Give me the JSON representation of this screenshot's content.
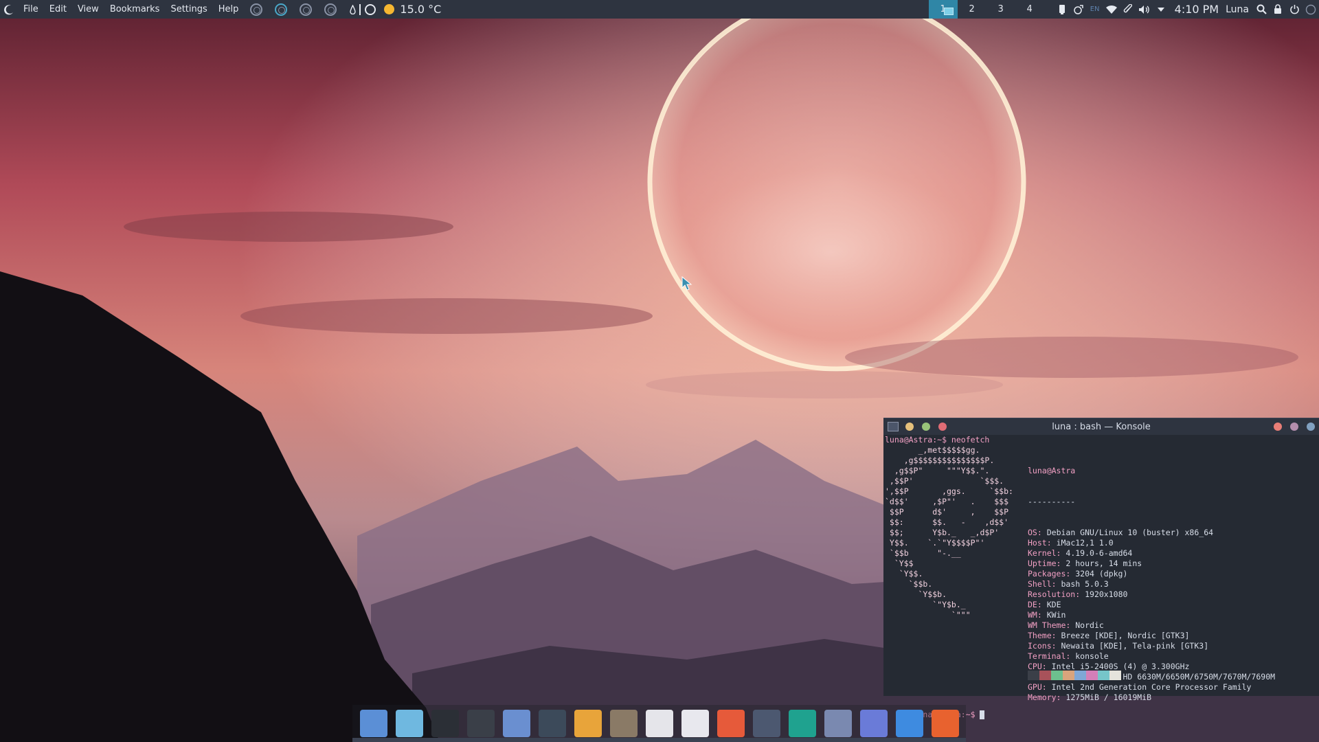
{
  "menu": [
    "File",
    "Edit",
    "View",
    "Bookmarks",
    "Settings",
    "Help"
  ],
  "weather": {
    "temperature": "15.0 °C"
  },
  "desktops": [
    "1",
    "2",
    "3",
    "4"
  ],
  "tray": {
    "keyboard_layout": "EN",
    "clock": "4:10 PM",
    "user": "Luna"
  },
  "konsole": {
    "title": "luna : bash — Konsole",
    "command_line": "luna@Astra:~$ neofetch",
    "prompt": "luna@Astra:~$ ",
    "logo_lines": [
      "       _,met$$$$$gg.",
      "    ,g$$$$$$$$$$$$$$$P.",
      "  ,g$$P\"     \"\"\"Y$$.\".",
      " ,$$P'              `$$$.",
      "',$$P       ,ggs.     `$$b:",
      "`d$$'     ,$P\"'   .    $$$",
      " $$P      d$'     ,    $$P",
      " $$:      $$.   -    ,d$$'",
      " $$;      Y$b._   _,d$P'",
      " Y$$.    `.`\"Y$$$$P\"'",
      " `$$b      \"-.__",
      "  `Y$$",
      "   `Y$$.",
      "     `$$b.",
      "       `Y$$b.",
      "          `\"Y$b._",
      "              `\"\"\""
    ],
    "info_header": "luna@Astra",
    "info_separator": "----------",
    "info": [
      {
        "k": "OS",
        "v": "Debian GNU/Linux 10 (buster) x86_64"
      },
      {
        "k": "Host",
        "v": "iMac12,1 1.0"
      },
      {
        "k": "Kernel",
        "v": "4.19.0-6-amd64"
      },
      {
        "k": "Uptime",
        "v": "2 hours, 14 mins"
      },
      {
        "k": "Packages",
        "v": "3204 (dpkg)"
      },
      {
        "k": "Shell",
        "v": "bash 5.0.3"
      },
      {
        "k": "Resolution",
        "v": "1920x1080"
      },
      {
        "k": "DE",
        "v": "KDE"
      },
      {
        "k": "WM",
        "v": "KWin"
      },
      {
        "k": "WM Theme",
        "v": "Nordic"
      },
      {
        "k": "Theme",
        "v": "Breeze [KDE], Nordic [GTK3]"
      },
      {
        "k": "Icons",
        "v": "Newaita [KDE], Tela-pink [GTK3]"
      },
      {
        "k": "Terminal",
        "v": "konsole"
      },
      {
        "k": "CPU",
        "v": "Intel i5-2400S (4) @ 3.300GHz"
      },
      {
        "k": "GPU",
        "v": "AMD ATI Radeon HD 6630M/6650M/6750M/7670M/7690M"
      },
      {
        "k": "GPU",
        "v": "Intel 2nd Generation Core Processor Family"
      },
      {
        "k": "Memory",
        "v": "1275MiB / 16019MiB"
      }
    ],
    "palette": [
      "#3b3f48",
      "#a8525a",
      "#6dbf8e",
      "#d9a47c",
      "#7fa7d6",
      "#d47fb8",
      "#76c5c9",
      "#e5e3dc"
    ]
  },
  "dock": [
    {
      "name": "discover-icon",
      "color": "#5b8fd6"
    },
    {
      "name": "disk-burner-icon",
      "color": "#6fb8e0"
    },
    {
      "name": "terminal-icon",
      "color": "#2b2f36"
    },
    {
      "name": "mixer-icon",
      "color": "#3a3f48"
    },
    {
      "name": "file-manager-icon",
      "color": "#6a8fd0"
    },
    {
      "name": "system-monitor-icon",
      "color": "#3c4a5a"
    },
    {
      "name": "notes-icon",
      "color": "#e8a43a"
    },
    {
      "name": "gimp-icon",
      "color": "#8a7a66"
    },
    {
      "name": "text-editor-icon",
      "color": "#e5e5ea"
    },
    {
      "name": "document-viewer-icon",
      "color": "#e8e8ee"
    },
    {
      "name": "app-grid-icon",
      "color": "#e65a3a"
    },
    {
      "name": "system-settings-icon",
      "color": "#4c5870"
    },
    {
      "name": "media-player-icon",
      "color": "#1fa28f"
    },
    {
      "name": "mail-client-icon",
      "color": "#7a89b0"
    },
    {
      "name": "chat-icon",
      "color": "#6a7bd8"
    },
    {
      "name": "downloader-icon",
      "color": "#3e8be0"
    },
    {
      "name": "firefox-icon",
      "color": "#e8622f"
    }
  ]
}
